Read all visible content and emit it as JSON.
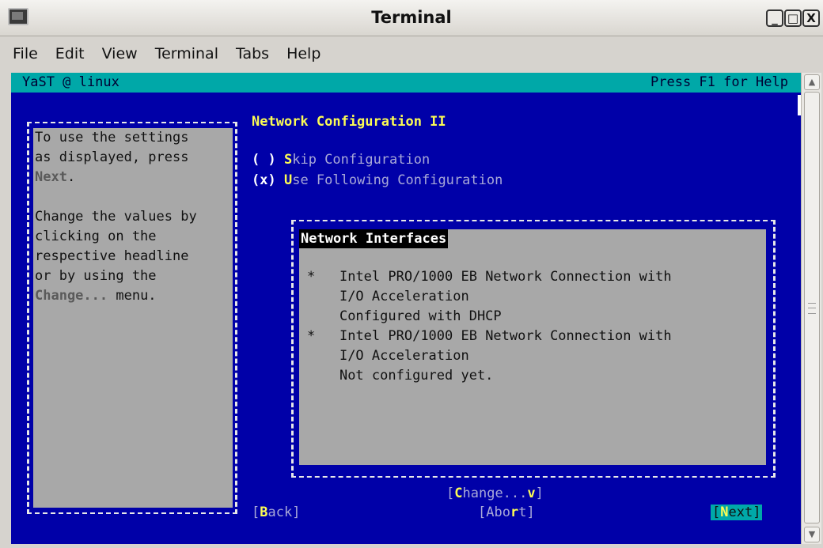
{
  "window": {
    "title": "Terminal",
    "minimize": "_",
    "maximize": "□",
    "close": "X"
  },
  "menubar": [
    "File",
    "Edit",
    "View",
    "Terminal",
    "Tabs",
    "Help"
  ],
  "statusbar": {
    "left": "YaST @ linux",
    "right": "Press F1 for Help"
  },
  "help": {
    "line1": "To use the settings",
    "line2": "as displayed, press",
    "next_word": "Next",
    "next_tail": ".",
    "line4": "Change the values by",
    "line5": "clicking on the",
    "line6": "respective headline",
    "line7": "or by using the",
    "change_word": "Change...",
    "change_tail": " menu."
  },
  "dialog": {
    "title": "Network Configuration II",
    "options": [
      {
        "mark": "( )",
        "hot": "S",
        "rest": "kip Configuration"
      },
      {
        "mark": "(x)",
        "hot": "U",
        "rest": "se Following Configuration"
      }
    ]
  },
  "interfaces": {
    "title": "Network Interfaces",
    "items": [
      {
        "bullet": "*",
        "line1": "Intel PRO/1000 EB Network Connection with",
        "line2": "I/O Acceleration",
        "status": "Configured with DHCP"
      },
      {
        "bullet": "*",
        "line1": "Intel PRO/1000 EB Network Connection with",
        "line2": "I/O Acceleration",
        "status": "Not configured yet."
      }
    ]
  },
  "buttons": {
    "change": {
      "pre": "[",
      "hot": "C",
      "mid": "hange...",
      "arrow": "v",
      "post": "]"
    },
    "back": {
      "pre": "[",
      "hot": "B",
      "mid": "ack]"
    },
    "abort": {
      "pre": "[Abo",
      "hot": "r",
      "mid": "t]"
    },
    "next": {
      "pre": "[",
      "hot": "N",
      "mid": "ext]"
    }
  }
}
